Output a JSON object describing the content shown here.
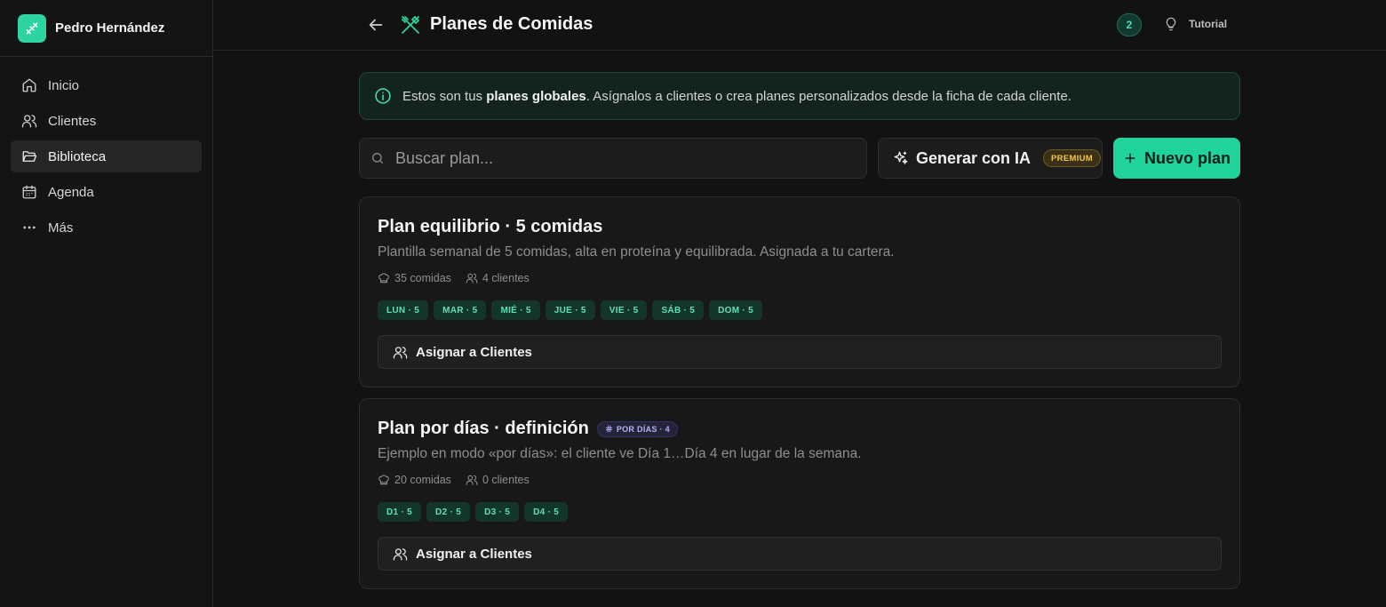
{
  "sidebar": {
    "user_name": "Pedro Hernández",
    "items": [
      {
        "label": "Inicio",
        "icon": "home-icon"
      },
      {
        "label": "Clientes",
        "icon": "users-icon"
      },
      {
        "label": "Biblioteca",
        "icon": "folder-open-icon",
        "active": true
      },
      {
        "label": "Agenda",
        "icon": "calendar-icon"
      },
      {
        "label": "Más",
        "icon": "more-dots-icon"
      }
    ]
  },
  "header": {
    "title": "Planes de Comidas",
    "notification_count": "2",
    "tutorial_label": "Tutorial"
  },
  "banner": {
    "text_before": "Estos son tus ",
    "text_bold": "planes globales",
    "text_after": ". Asígnalos a clientes o crea planes personalizados desde la ficha de cada cliente."
  },
  "toolbar": {
    "search_placeholder": "Buscar plan...",
    "ai_label": "Generar con IA",
    "premium_badge": "PREMIUM",
    "new_plan_label": "Nuevo plan"
  },
  "plans": [
    {
      "title": "Plan equilibrio · 5 comidas",
      "badge": "",
      "description": "Plantilla semanal de 5 comidas, alta en proteína y equilibrada. Asignada a tu cartera.",
      "meals": "35 comidas",
      "clients": "4 clientes",
      "chips": [
        "LUN · 5",
        "MAR · 5",
        "MIÉ · 5",
        "JUE · 5",
        "VIE · 5",
        "SÁB · 5",
        "DOM · 5"
      ],
      "assign_label": "Asignar a Clientes"
    },
    {
      "title": "Plan por días · definición",
      "badge": "POR DÍAS · 4",
      "description": "Ejemplo en modo «por días»: el cliente ve Día 1…Día 4 en lugar de la semana.",
      "meals": "20 comidas",
      "clients": "0 clientes",
      "chips": [
        "D1 · 5",
        "D2 · 5",
        "D3 · 5",
        "D4 · 5"
      ],
      "assign_label": "Asignar a Clientes"
    }
  ],
  "colors": {
    "accent": "#1fd39b",
    "background": "#121212",
    "premium": "#f0c64a"
  }
}
